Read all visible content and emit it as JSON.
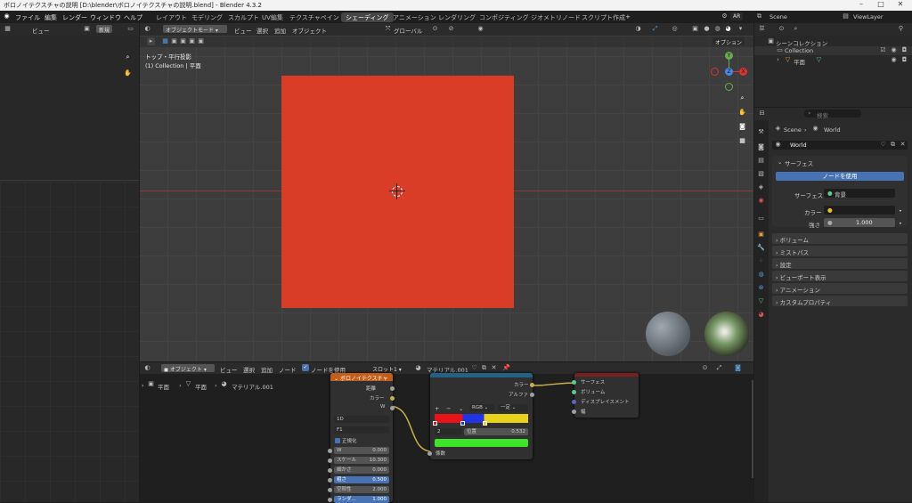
{
  "window": {
    "title": "ボロノイテクスチャの説明 [D:\\blender\\ボロノイテクスチャの説明.blend] - Blender 4.3.2"
  },
  "menu": [
    "ファイル",
    "編集",
    "レンダー",
    "ウィンドウ",
    "ヘルプ"
  ],
  "workspaces": [
    "レイアウト",
    "モデリング",
    "スカルプト",
    "UV編集",
    "テクスチャペイント",
    "シェーディング",
    "アニメーション",
    "レンダリング",
    "コンポジティング",
    "ジオメトリノード",
    "スクリプト作成"
  ],
  "topright": {
    "lang": "AR",
    "scene": "Scene",
    "viewlayer": "ViewLayer"
  },
  "filebrowser": {
    "view": "ビュー",
    "new": "新規"
  },
  "viewport": {
    "mode": "オブジェクトモード",
    "menus": [
      "ビュー",
      "選択",
      "追加",
      "オブジェクト"
    ],
    "orient": "グローバル",
    "options": "オプション",
    "view_name": "トップ・平行投影",
    "collection": "(1) Collection | 平面",
    "plane_color": "#d93d28",
    "gizmo": {
      "y": "Y",
      "z": "Z",
      "x": "X"
    }
  },
  "outliner": {
    "title": "シーンコレクション",
    "collection": "Collection",
    "object": "平面"
  },
  "properties": {
    "search_placeholder": "検索",
    "crumb": [
      "Scene",
      "World"
    ],
    "world_name": "World",
    "surface_header": "サーフェス",
    "use_nodes": "ノードを使用",
    "surface_label": "サーフェス",
    "surface_value": "背景",
    "color_label": "カラー",
    "strength_label": "強さ",
    "strength_value": "1.000",
    "sections": [
      "ボリューム",
      "ミストパス",
      "設定",
      "ビューポート表示",
      "アニメーション",
      "カスタムプロパティ"
    ]
  },
  "node_editor": {
    "type": "オブジェクト",
    "menus": [
      "ビュー",
      "選択",
      "追加",
      "ノード"
    ],
    "use_nodes": "ノードを使用",
    "slot": "スロット1",
    "material": "マテリアル.001",
    "crumb": [
      "平面",
      "平面",
      "マテリアル.001"
    ]
  },
  "voronoi": {
    "title": "ボロノイテクスチャ",
    "outputs": [
      "距離",
      "カラー",
      "W"
    ],
    "dim": "1D",
    "metric": "F1",
    "normalize": "正規化",
    "fields": [
      [
        "W",
        "0.000"
      ],
      [
        "スケール",
        "10.300"
      ],
      [
        "細かさ",
        "0.000"
      ],
      [
        "粗さ",
        "0.500"
      ],
      [
        "空隙性",
        "2.000"
      ],
      [
        "ランダ...",
        "1.000"
      ]
    ]
  },
  "colorramp": {
    "outputs": [
      "カラー",
      "アルファ"
    ],
    "mode": "RGB",
    "interp": "一定",
    "index": "2",
    "pos_label": "位置",
    "pos_value": "0.532",
    "input": "係数"
  },
  "output_node": {
    "inputs": [
      "サーフェス",
      "ボリューム",
      "ディスプレイスメント",
      "幅"
    ]
  }
}
